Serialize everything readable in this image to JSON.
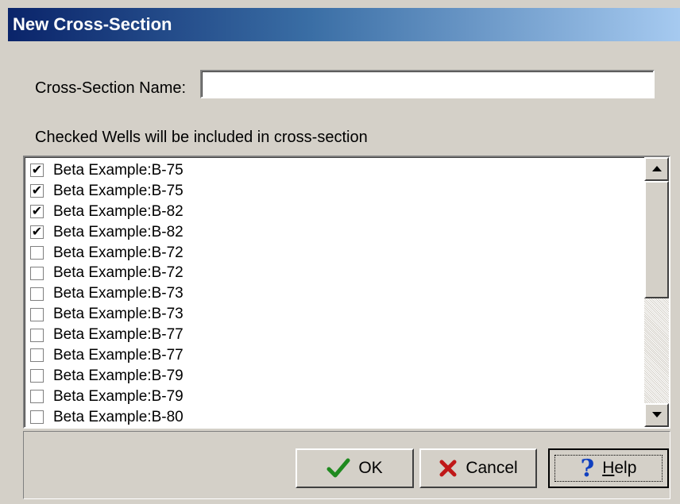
{
  "window": {
    "title": "New Cross-Section"
  },
  "form": {
    "name_label": "Cross-Section Name:",
    "name_value": "",
    "hint": "Checked Wells will be included in cross-section"
  },
  "wells": [
    {
      "label": "Beta Example:B-75",
      "checked": true
    },
    {
      "label": "Beta Example:B-75",
      "checked": true
    },
    {
      "label": "Beta Example:B-82",
      "checked": true
    },
    {
      "label": "Beta Example:B-82",
      "checked": true
    },
    {
      "label": "Beta Example:B-72",
      "checked": false
    },
    {
      "label": "Beta Example:B-72",
      "checked": false
    },
    {
      "label": "Beta Example:B-73",
      "checked": false
    },
    {
      "label": "Beta Example:B-73",
      "checked": false
    },
    {
      "label": "Beta Example:B-77",
      "checked": false
    },
    {
      "label": "Beta Example:B-77",
      "checked": false
    },
    {
      "label": "Beta Example:B-79",
      "checked": false
    },
    {
      "label": "Beta Example:B-79",
      "checked": false
    },
    {
      "label": "Beta Example:B-80",
      "checked": false
    }
  ],
  "buttons": {
    "ok": "OK",
    "cancel": "Cancel",
    "help_prefix": "H",
    "help_rest": "elp"
  },
  "icons": {
    "ok": "check-icon",
    "cancel": "x-icon",
    "help": "question-mark-icon",
    "scroll_up": "arrow-up-icon",
    "scroll_down": "arrow-down-icon"
  },
  "colors": {
    "title_bar_start": "#0a246a",
    "title_bar_end": "#a6caf0",
    "ok_icon": "#1f8a1f",
    "cancel_icon": "#c01818",
    "help_icon": "#1040c0"
  }
}
